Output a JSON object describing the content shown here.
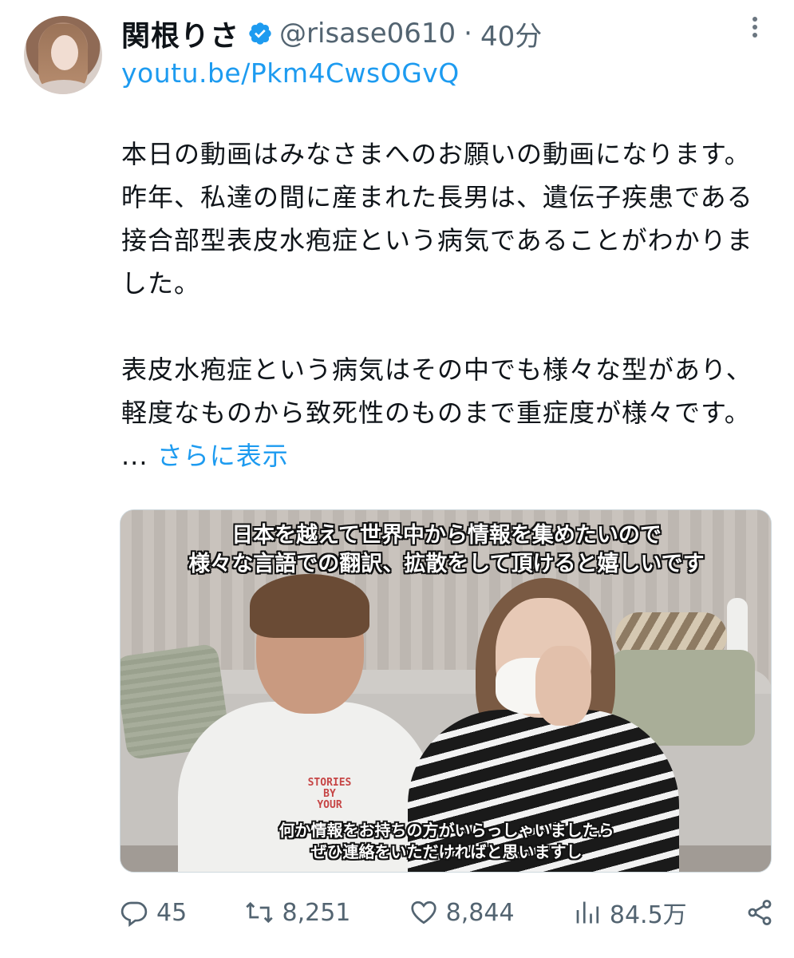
{
  "author": {
    "display_name": "関根りさ",
    "handle": "@risase0610",
    "separator": "·",
    "time": "40分",
    "verified": true
  },
  "link": "youtu.be/Pkm4CwsOGvQ",
  "body": {
    "text": "本日の動画はみなさまへのお願いの動画になります。\n昨年、私達の間に産まれた長男は、遺伝子疾患である接合部型表皮水疱症という病気であることがわかりました。\n\n表皮水疱症という病気はその中でも様々な型があり、軽度なものから致死性のものまで重症度が様々です。 ... ",
    "show_more": "さらに表示"
  },
  "media": {
    "caption_top": "日本を越えて世界中から情報を集めたいので\n様々な言語での翻訳、拡散をして頂けると嬉しいです",
    "caption_bottom": "何か情報をお持ちの方がいらっしゃいましたら\nぜひ連絡をいただければと思いますし",
    "shirt_text": "STORIES\nBY\nYOUR"
  },
  "actions": {
    "replies": "45",
    "reposts": "8,251",
    "likes": "8,844",
    "views": "84.5万"
  },
  "colors": {
    "accent": "#1d9bf0",
    "muted": "#536471"
  }
}
